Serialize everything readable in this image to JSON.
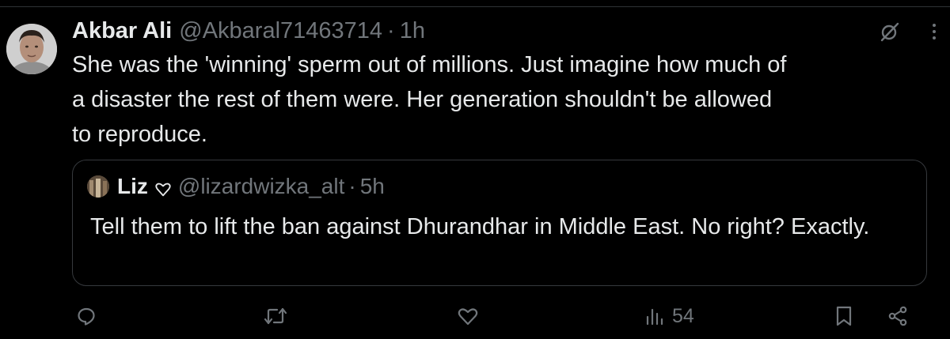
{
  "tweet": {
    "author": {
      "name": "Akbar Ali",
      "handle": "@Akbaral71463714",
      "separator": "·",
      "time": "1h"
    },
    "text": "She was the 'winning' sperm out of millions. Just imagine how much of\na disaster the rest of them were. Her generation shouldn't be allowed\nto reproduce.",
    "quoted": {
      "name": "Liz",
      "handle": "@lizardwizka_alt",
      "separator": "·",
      "time": "5h",
      "text": "Tell them to lift the ban against Dhurandhar in Middle East. No right? Exactly."
    },
    "actions": {
      "reply_icon": "reply-icon",
      "retweet_icon": "retweet-icon",
      "like_icon": "heart-icon",
      "views_icon": "views-icon",
      "views_count": "54",
      "bookmark_icon": "bookmark-icon",
      "share_icon": "share-icon"
    },
    "header_icons": {
      "grok": "grok-icon",
      "more": "more-icon"
    }
  },
  "colors": {
    "background": "#000000",
    "text": "#e7e9ea",
    "muted": "#71767b",
    "border": "#2f3336"
  }
}
